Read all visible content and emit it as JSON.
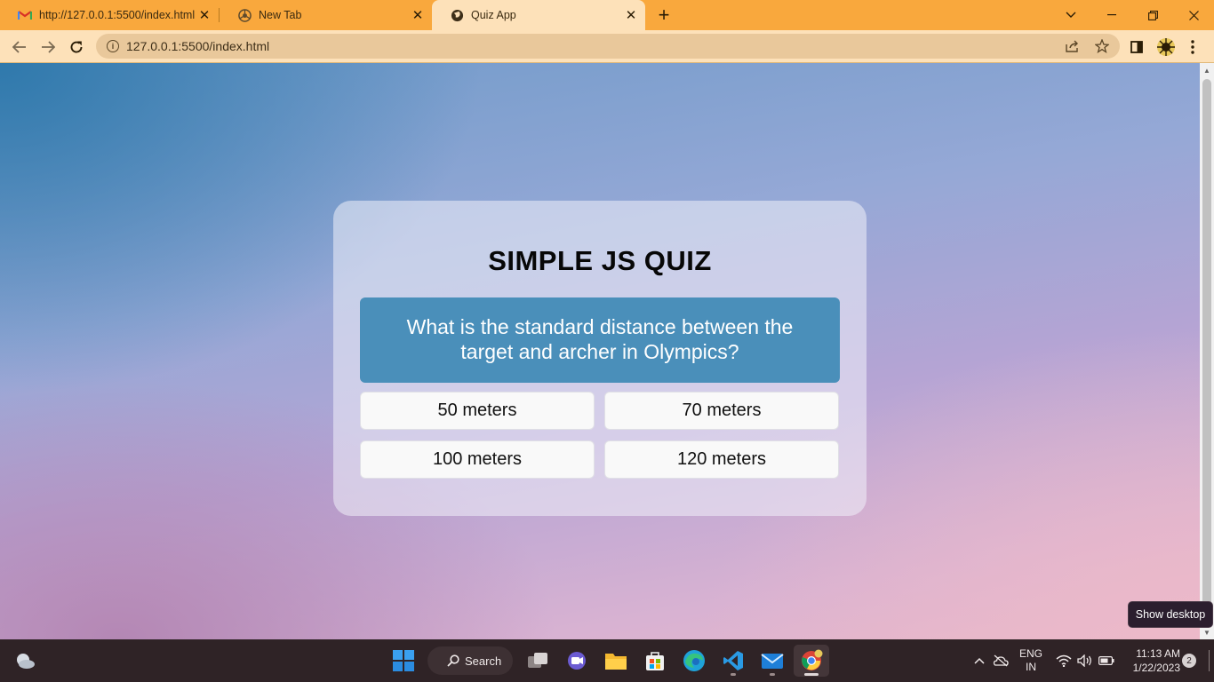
{
  "browser": {
    "tabs": [
      {
        "title": "http://127.0.0.1:5500/index.html",
        "icon": "gmail-icon",
        "active": false
      },
      {
        "title": "New Tab",
        "icon": "chrome-icon",
        "active": false
      },
      {
        "title": "Quiz App",
        "icon": "globe-icon",
        "active": true
      }
    ],
    "address": "127.0.0.1:5500/index.html"
  },
  "quiz": {
    "title": "SIMPLE JS QUIZ",
    "question": "What is the standard distance between the target and archer in Olympics?",
    "answers": [
      "50 meters",
      "70 meters",
      "100 meters",
      "120 meters"
    ]
  },
  "tooltip": "Show desktop",
  "taskbar": {
    "search_label": "Search",
    "language_top": "ENG",
    "language_bottom": "IN",
    "time": "11:13 AM",
    "date": "1/22/2023",
    "notification_count": "2"
  },
  "colors": {
    "tab_strip": "#f9a83d",
    "toolbar": "#fde1b9",
    "question_bg": "#4a8fba",
    "taskbar": "#2f2326"
  }
}
